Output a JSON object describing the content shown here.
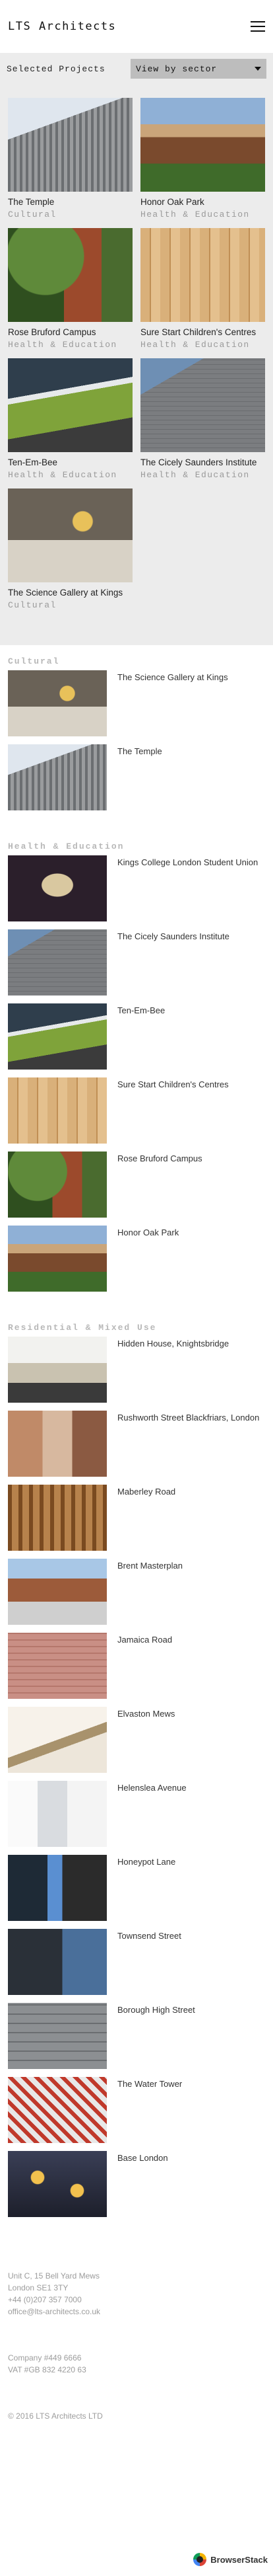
{
  "header": {
    "logo": "LTS Architects"
  },
  "filter": {
    "title": "Selected Projects",
    "select_value": "View by sector"
  },
  "featured": [
    {
      "title": "The Temple",
      "category": "Cultural",
      "image": "concrete-building-photo"
    },
    {
      "title": "Honor Oak Park",
      "category": "Health & Education",
      "image": "brick-building-photo"
    },
    {
      "title": "Rose Bruford Campus",
      "category": "Health & Education",
      "image": "garden-building-photo"
    },
    {
      "title": "Sure Start Children's Centres",
      "category": "Health & Education",
      "image": "timber-cladding-photo"
    },
    {
      "title": "Ten-Em-Bee",
      "category": "Health & Education",
      "image": "green-canopy-photo"
    },
    {
      "title": "The Cicely Saunders Institute",
      "category": "Health & Education",
      "image": "grey-brick-building-photo"
    },
    {
      "title": "The Science Gallery at Kings",
      "category": "Cultural",
      "image": "gallery-facade-photo"
    }
  ],
  "sectors": [
    {
      "name": "Cultural",
      "projects": [
        {
          "title": "The Science Gallery at Kings",
          "image": "gallery-facade-photo"
        },
        {
          "title": "The Temple",
          "image": "concrete-building-photo"
        }
      ]
    },
    {
      "name": "Health & Education",
      "projects": [
        {
          "title": "Kings College London Student Union",
          "image": "arched-interior-photo"
        },
        {
          "title": "The Cicely Saunders Institute",
          "image": "grey-brick-building-photo"
        },
        {
          "title": "Ten-Em-Bee",
          "image": "green-canopy-photo"
        },
        {
          "title": "Sure Start Children's Centres",
          "image": "timber-cladding-photo"
        },
        {
          "title": "Rose Bruford Campus",
          "image": "garden-building-photo"
        },
        {
          "title": "Honor Oak Park",
          "image": "brick-building-photo"
        }
      ]
    },
    {
      "name": "Residential & Mixed Use",
      "projects": [
        {
          "title": "Hidden House, Knightsbridge",
          "image": "white-interior-photo"
        },
        {
          "title": "Rushworth Street Blackfriars, London",
          "image": "brick-apartment-photo"
        },
        {
          "title": "Maberley Road",
          "image": "timber-pergola-photo"
        },
        {
          "title": "Brent Masterplan",
          "image": "blocks-street-photo"
        },
        {
          "title": "Jamaica Road",
          "image": "pink-brick-photo"
        },
        {
          "title": "Elvaston Mews",
          "image": "bright-interior-photo"
        },
        {
          "title": "Helenslea Avenue",
          "image": "white-room-photo"
        },
        {
          "title": "Honeypot Lane",
          "image": "dark-cladding-photo"
        },
        {
          "title": "Townsend Street",
          "image": "dark-building-photo"
        },
        {
          "title": "Borough High Street",
          "image": "grey-facade-photo"
        },
        {
          "title": "The Water Tower",
          "image": "red-stair-photo"
        },
        {
          "title": "Base London",
          "image": "lit-windows-photo"
        }
      ]
    }
  ],
  "footer": {
    "address1": "Unit C, 15 Bell Yard Mews",
    "address2": "London SE1 3TY",
    "phone": "+44 (0)207 357 7000",
    "email": "office@lts-architects.co.uk",
    "company": "Company #449 6666",
    "vat": "VAT #GB 832 4220 63",
    "copyright": "© 2016 LTS Architects LTD",
    "badge": "BrowserStack"
  }
}
